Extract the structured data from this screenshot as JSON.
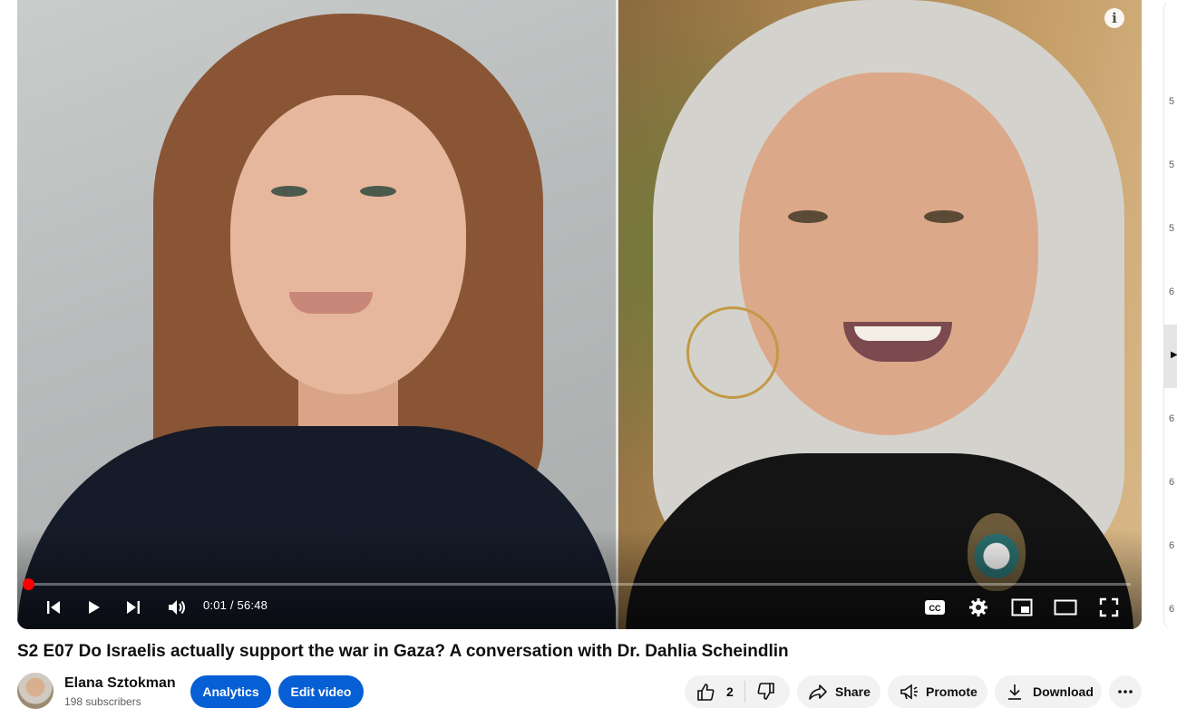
{
  "video": {
    "current_time": "0:01",
    "duration": "56:48",
    "time_display": "0:01 / 56:48",
    "progress_fraction": 0.0003,
    "info_glyph": "i"
  },
  "controls": {
    "previous": "previous-icon",
    "play": "play-icon",
    "next": "next-icon",
    "volume": "volume-icon",
    "captions": "cc-icon",
    "settings": "gear-icon",
    "miniplayer": "miniplayer-icon",
    "theater": "theater-icon",
    "fullscreen": "fullscreen-icon"
  },
  "title": "S2 E07 Do Israelis actually support the war in Gaza? A conversation with Dr. Dahlia Scheindlin",
  "channel": {
    "name": "Elana Sztokman",
    "subscribers": "198 subscribers"
  },
  "actions": {
    "analytics": "Analytics",
    "edit_video": "Edit video",
    "likes": "2",
    "share": "Share",
    "promote": "Promote",
    "download": "Download"
  },
  "sidebar_numbers": [
    "5",
    "5",
    "5",
    "6",
    "6",
    "6",
    "6",
    "6"
  ],
  "colors": {
    "accent_blue": "#065fd4",
    "progress_red": "#ff0000",
    "pill_grey": "#f2f2f2"
  }
}
